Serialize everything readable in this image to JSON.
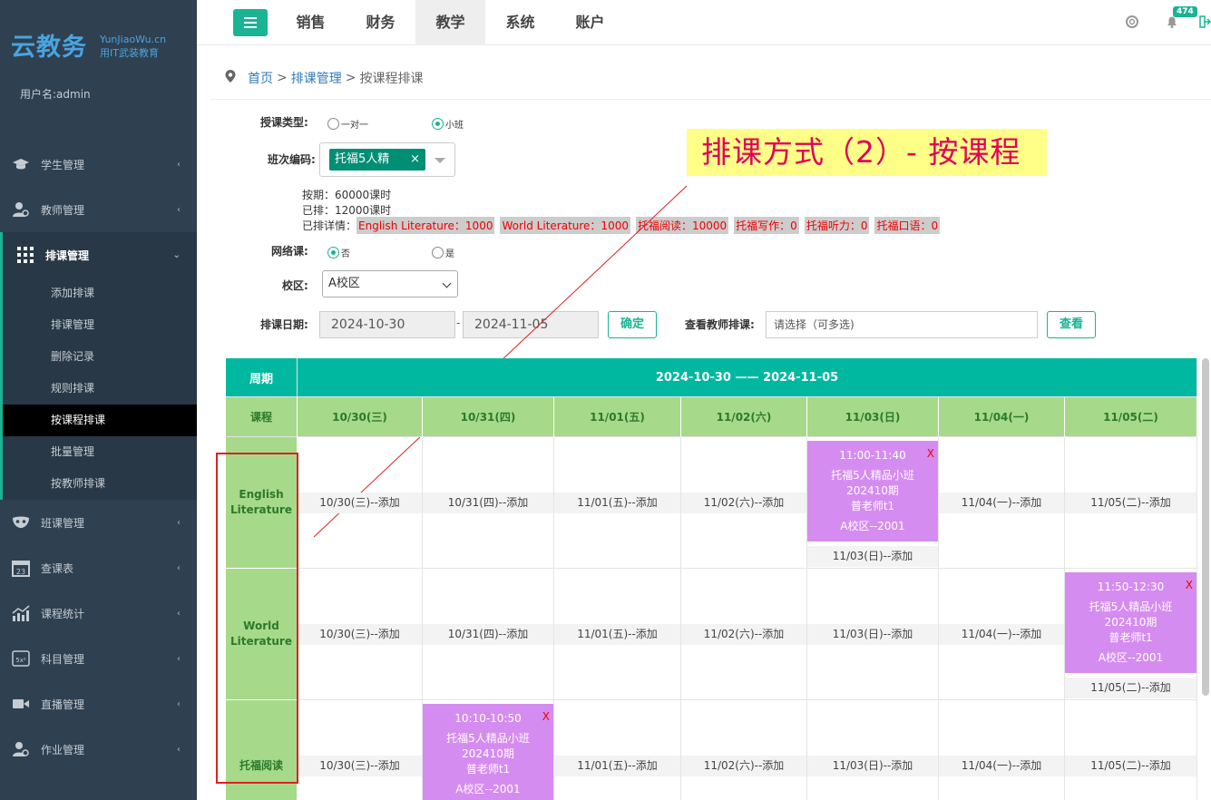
{
  "brand": {
    "name": "云教务",
    "site": "YunJiaoWu.cn",
    "slogan": "用IT武装教育"
  },
  "user": {
    "label": "用户名:admin"
  },
  "sidebar": {
    "items": [
      {
        "label": "学生管理",
        "icon": "graduation-cap-icon"
      },
      {
        "label": "教师管理",
        "icon": "teacher-icon"
      },
      {
        "label": "排课管理",
        "icon": "grid-icon",
        "active": true,
        "sub": [
          "添加排课",
          "排课管理",
          "删除记录",
          "规则排课",
          "按课程排课",
          "批量管理",
          "按教师排课"
        ],
        "current": "按课程排课"
      },
      {
        "label": "班课管理",
        "icon": "mask-icon"
      },
      {
        "label": "查课表",
        "icon": "calendar-icon"
      },
      {
        "label": "课程统计",
        "icon": "bar-chart-icon"
      },
      {
        "label": "科目管理",
        "icon": "formula-icon"
      },
      {
        "label": "直播管理",
        "icon": "video-camera-icon"
      },
      {
        "label": "作业管理",
        "icon": "user-gear-icon"
      }
    ]
  },
  "topnav": {
    "items": [
      "销售",
      "财务",
      "教学",
      "系统",
      "账户"
    ],
    "active": "教学",
    "badge": "474"
  },
  "breadcrumb": {
    "home": "首页",
    "parent": "排课管理",
    "current": "按课程排课",
    "sep": ">"
  },
  "form": {
    "type_label": "授课类型:",
    "type_opt1": "一对一",
    "type_opt2": "小班",
    "class_label": "班次编码:",
    "class_tag": "托福5人精",
    "tag_close": "×",
    "period": "按期：60000课时",
    "scheduled": "已排：12000课时",
    "detail_label": "已排详情：",
    "details": [
      "English Literature：1000",
      "World Literature：1000",
      "托福阅读：10000",
      "托福写作：0",
      "托福听力：0",
      "托福口语：0"
    ],
    "online_label": "网络课:",
    "online_no": "否",
    "online_yes": "是",
    "campus_label": "校区:",
    "campus_value": "A校区",
    "date_label": "排课日期:",
    "date_from": "2024-10-30",
    "date_sep": "-",
    "date_to": "2024-11-05",
    "confirm": "确定",
    "teacher_label": "查看教师排课:",
    "teacher_placeholder": "请选择（可多选)",
    "view": "查看"
  },
  "annotation": "排课方式（2）- 按课程",
  "schedule": {
    "week_label": "周期",
    "range": "2024-10-30 —— 2024-11-05",
    "course_label": "课程",
    "days": [
      "10/30(三)",
      "10/31(四)",
      "11/01(五)",
      "11/02(六)",
      "11/03(日)",
      "11/04(一)",
      "11/05(二)"
    ],
    "add_suffix": "--添加",
    "courses": [
      {
        "name1": "English",
        "name2": "Literature"
      },
      {
        "name1": "World",
        "name2": "Literature"
      },
      {
        "name1": "托福阅读",
        "name2": ""
      }
    ],
    "lessons": [
      {
        "course": 0,
        "day": 4,
        "time": "11:00-11:40",
        "l1": "托福5人精品小班",
        "l2": "202410期",
        "l3": "普老师t1",
        "l4": "A校区--2001",
        "del": "X"
      },
      {
        "course": 1,
        "day": 6,
        "time": "11:50-12:30",
        "l1": "托福5人精品小班",
        "l2": "202410期",
        "l3": "普老师t1",
        "l4": "A校区--2001",
        "del": "X"
      },
      {
        "course": 2,
        "day": 1,
        "time": "10:10-10:50",
        "l1": "托福5人精品小班",
        "l2": "202410期",
        "l3": "普老师t1",
        "l4": "A校区--2001",
        "del": "X"
      }
    ]
  },
  "colors": {
    "accent": "#1ab394",
    "sidebar": "#2f4050",
    "header": "#00b8a0",
    "day_header": "#a7d98b",
    "lesson": "#d58cf0"
  }
}
